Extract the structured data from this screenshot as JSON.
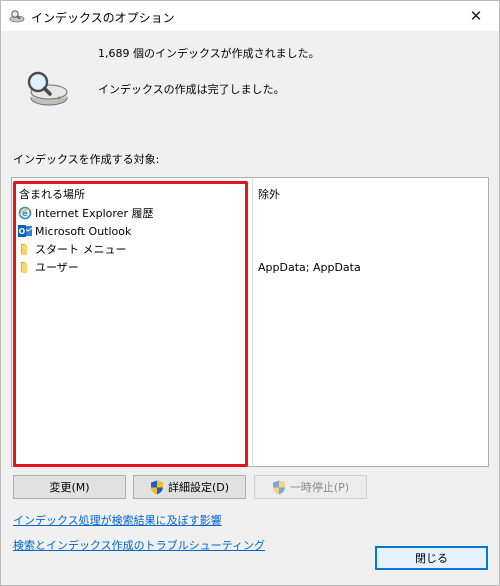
{
  "window": {
    "title": "インデックスのオプション",
    "close_glyph": "✕"
  },
  "status": {
    "count_text": "1,689 個のインデックスが作成されました。",
    "state_text": "インデックスの作成は完了しました。"
  },
  "section_label": "インデックスを作成する対象:",
  "list": {
    "included_header": "含まれる場所",
    "excluded_header": "除外",
    "items": [
      {
        "label": "Internet Explorer 履歴",
        "icon": "internet-explorer-icon",
        "excluded": ""
      },
      {
        "label": "Microsoft Outlook",
        "icon": "outlook-icon",
        "excluded": ""
      },
      {
        "label": "スタート メニュー",
        "icon": "folder-icon",
        "excluded": ""
      },
      {
        "label": "ユーザー",
        "icon": "folder-icon",
        "excluded": "AppData; AppData"
      }
    ]
  },
  "buttons": {
    "modify": "変更(M)",
    "advanced": "詳細設定(D)",
    "pause": "一時停止(P)",
    "close": "閉じる"
  },
  "links": {
    "effect": "インデックス処理が検索結果に及ぼす影響",
    "troubleshoot": "検索とインデックス作成のトラブルシューティング"
  },
  "colors": {
    "highlight": "#e8141c",
    "link": "#0066cc",
    "default_button_border": "#0078d7"
  }
}
